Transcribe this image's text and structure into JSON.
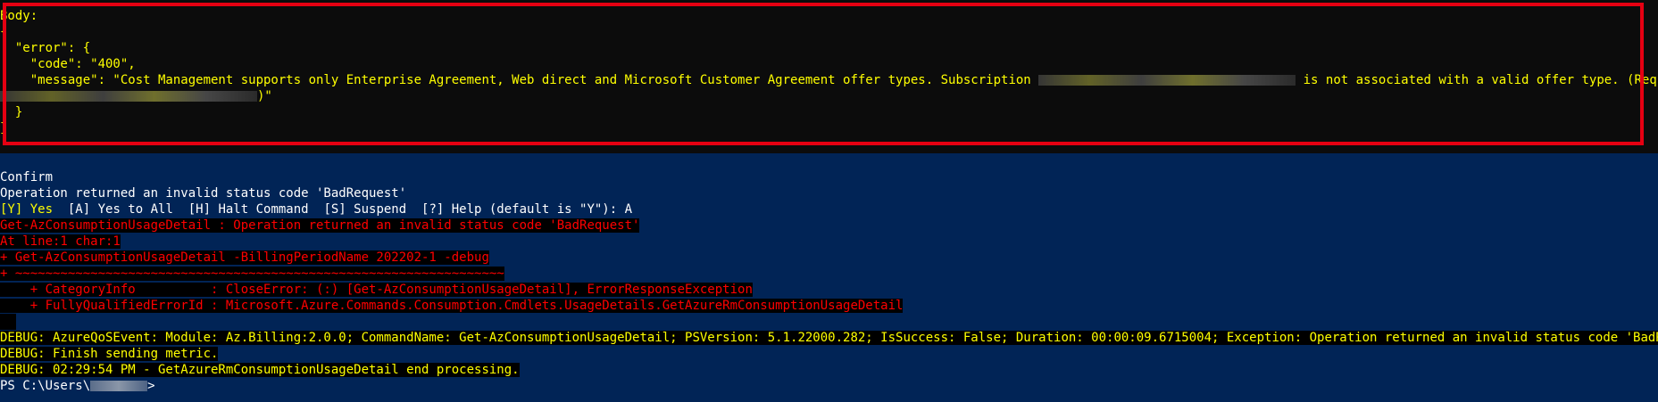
{
  "body_block": {
    "l1": "Body:",
    "l2": "{",
    "l3": "  \"error\": {",
    "l4": "    \"code\": \"400\",",
    "l5a": "    \"message\": \"Cost Management supports only Enterprise Agreement, Web direct and Microsoft Customer Agreement offer types. Subscription ",
    "l5b": " is not associated with a valid offer type. (Request ID:",
    "l6b": ")\"",
    "l7": "  }",
    "l8": "}"
  },
  "confirm": {
    "title": "Confirm",
    "message": "Operation returned an invalid status code 'BadRequest'",
    "choice_yes": "[Y] Yes",
    "choice_rest": "  [A] Yes to All  [H] Halt Command  [S] Suspend  [?] Help (default is \"Y\"): A"
  },
  "error": {
    "e1": "Get-AzConsumptionUsageDetail : Operation returned an invalid status code 'BadRequest'",
    "e2": "At line:1 char:1",
    "e3": "+ Get-AzConsumptionUsageDetail -BillingPeriodName 202202-1 -debug",
    "e4": "+ ~~~~~~~~~~~~~~~~~~~~~~~~~~~~~~~~~~~~~~~~~~~~~~~~~~~~~~~~~~~~~~~~~",
    "e5": "    + CategoryInfo          : CloseError: (:) [Get-AzConsumptionUsageDetail], ErrorResponseException",
    "e6": "    + FullyQualifiedErrorId : Microsoft.Azure.Commands.Consumption.Cmdlets.UsageDetails.GetAzureRmConsumptionUsageDetail"
  },
  "debug": {
    "d1": "DEBUG: AzureQoSEvent: Module: Az.Billing:2.0.0; CommandName: Get-AzConsumptionUsageDetail; PSVersion: 5.1.22000.282; IsSuccess: False; Duration: 00:00:09.6715004; Exception: Operation returned an invalid status code 'BadRequest';",
    "d2": "DEBUG: Finish sending metric.",
    "d3": "DEBUG: 02:29:54 PM - GetAzureRmConsumptionUsageDetail end processing."
  },
  "prompt": {
    "prefix": "PS C:\\Users\\",
    "suffix": ">"
  },
  "colors": {
    "frame": "#e60012",
    "console_bg": "#012456",
    "warning": "#ffff00",
    "error": "#ff0000"
  }
}
